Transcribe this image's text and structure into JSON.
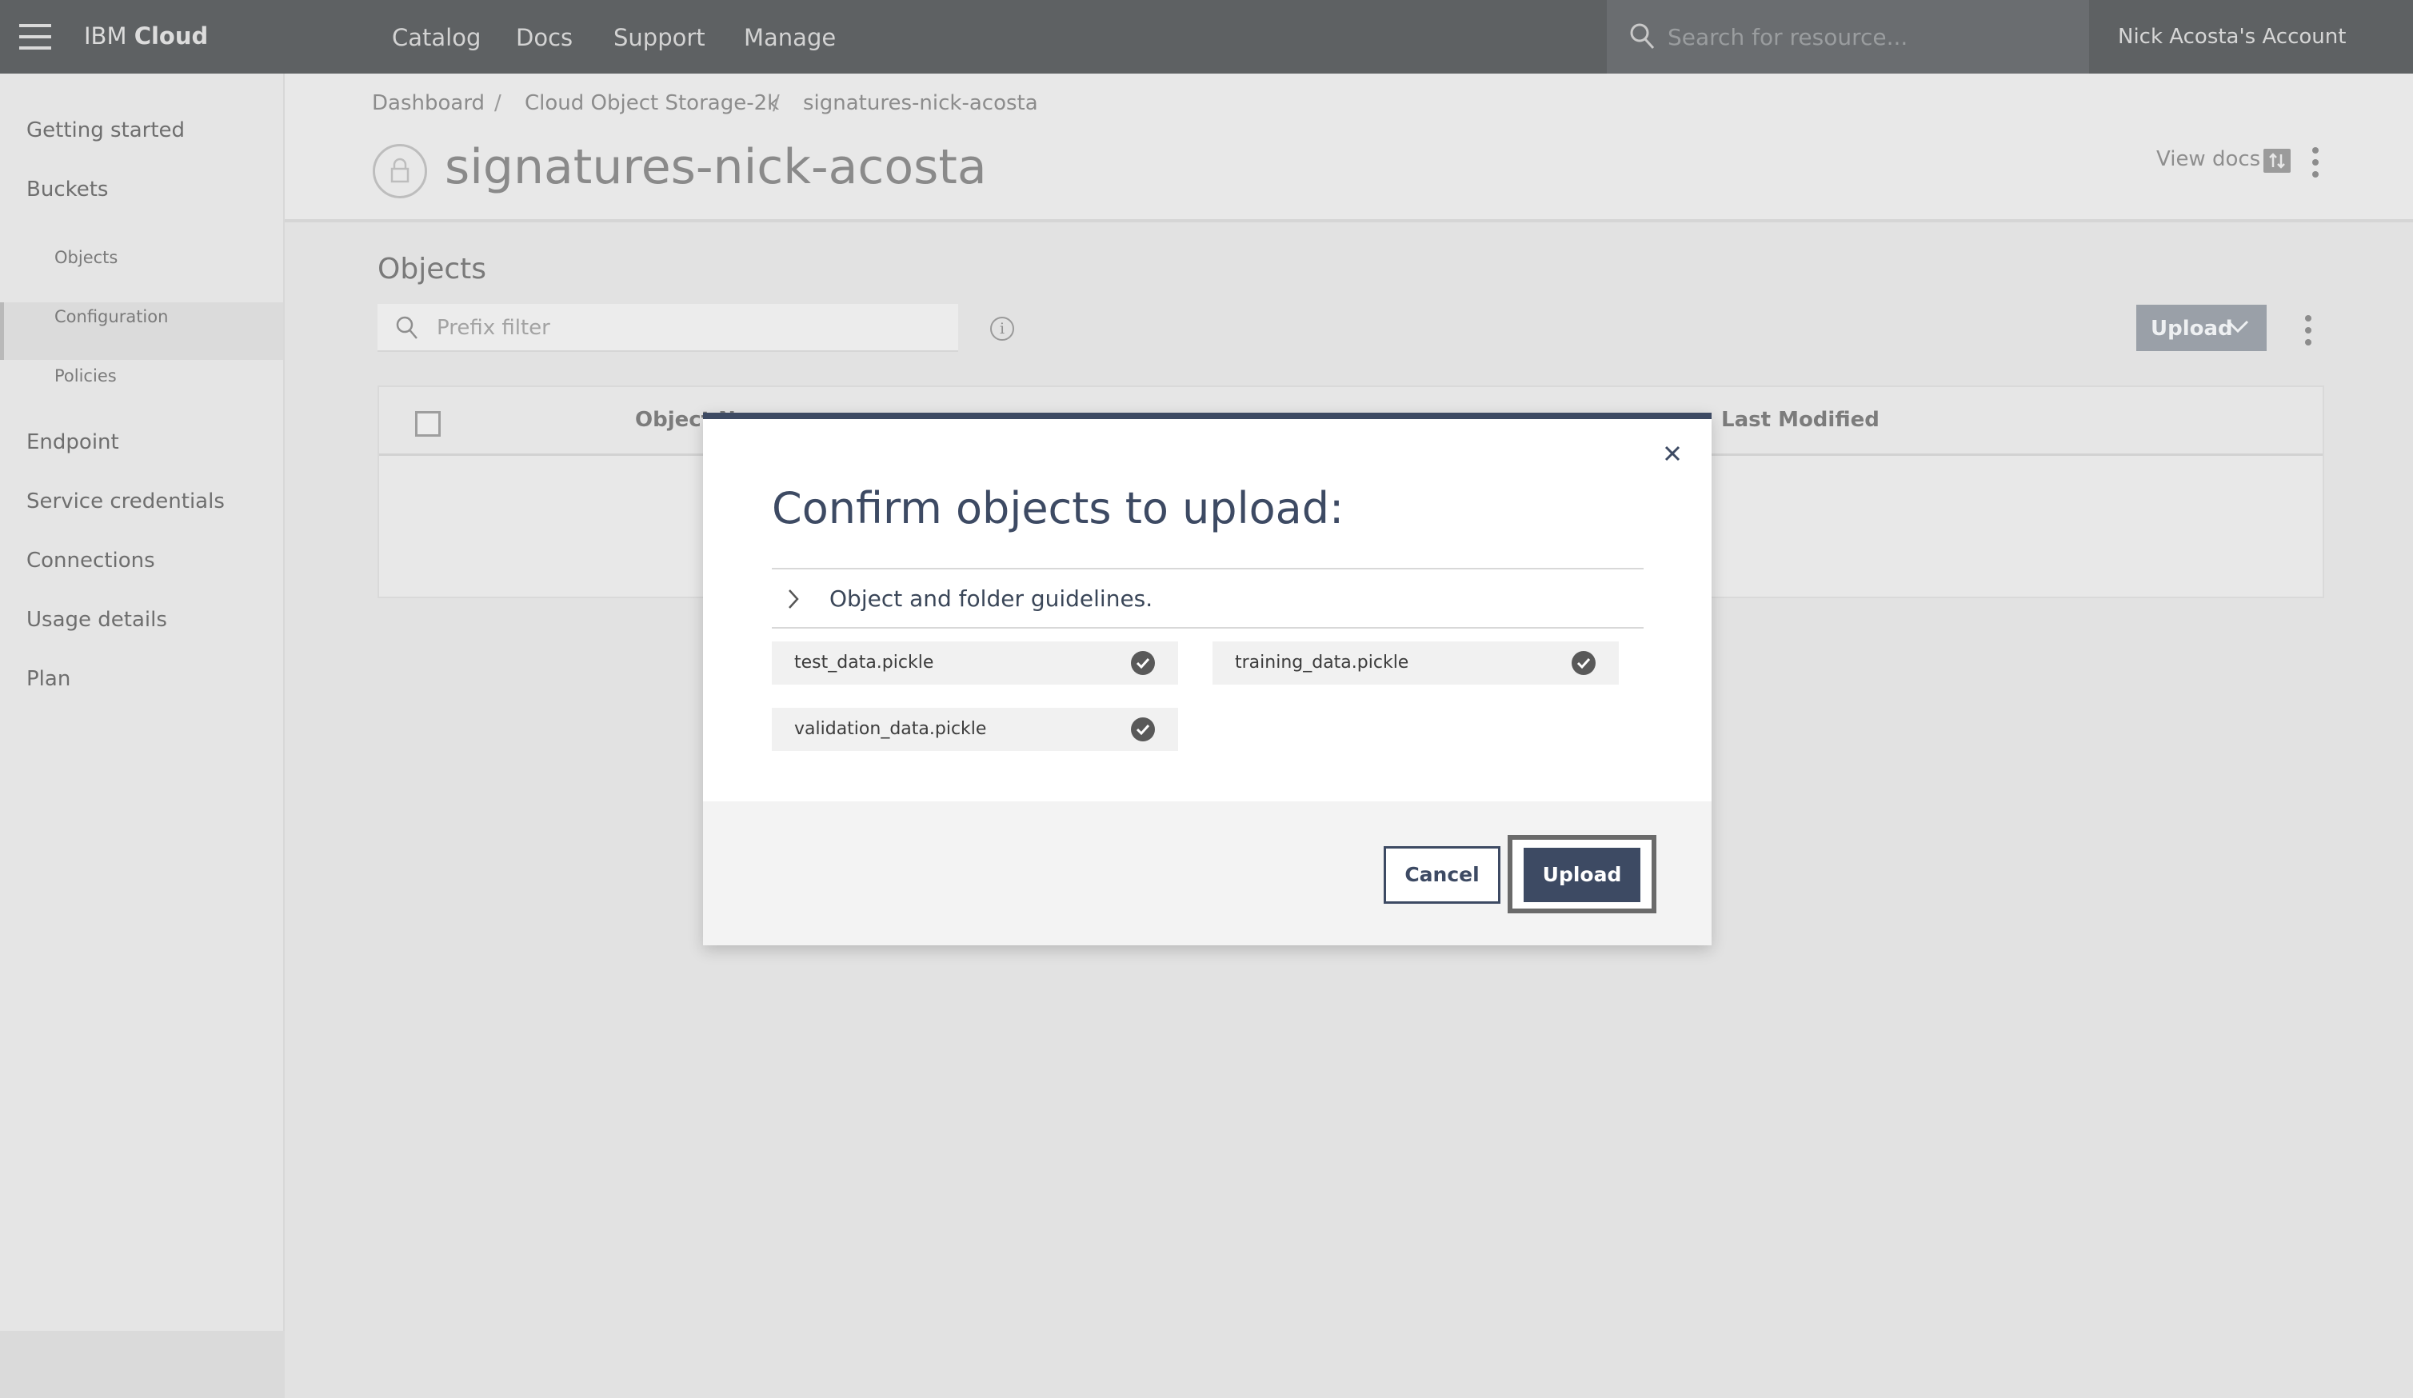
{
  "header": {
    "brand_plain": "IBM ",
    "brand_bold": "Cloud",
    "nav": [
      "Catalog",
      "Docs",
      "Support",
      "Manage"
    ],
    "search_placeholder": "Search for resource...",
    "account": "Nick Acosta's Account"
  },
  "sidebar": {
    "items": [
      {
        "label": "Getting started"
      },
      {
        "label": "Buckets"
      },
      {
        "label": "Objects"
      },
      {
        "label": "Configuration"
      },
      {
        "label": "Policies"
      },
      {
        "label": "Endpoint"
      },
      {
        "label": "Service credentials"
      },
      {
        "label": "Connections"
      },
      {
        "label": "Usage details"
      },
      {
        "label": "Plan"
      }
    ],
    "active": "Objects"
  },
  "page": {
    "breadcrumb": [
      "Dashboard",
      "Cloud Object Storage-2k",
      "signatures-nick-acosta"
    ],
    "title": "signatures-nick-acosta",
    "view_docs": "View docs"
  },
  "objects": {
    "title": "Objects",
    "filter_placeholder": "Prefix filter",
    "info_glyph": "i",
    "upload_label": "Upload",
    "columns": [
      "Object N",
      "Last Modified"
    ]
  },
  "modal": {
    "title": "Confirm objects to upload:",
    "guidelines": "Object and folder guidelines.",
    "files": [
      "test_data.pickle",
      "training_data.pickle",
      "validation_data.pickle"
    ],
    "cancel": "Cancel",
    "upload": "Upload"
  },
  "colors": {
    "nav_bg": "#5e6163",
    "accent": "#3d4a63",
    "overlay_bg": "#e2e2e2"
  }
}
